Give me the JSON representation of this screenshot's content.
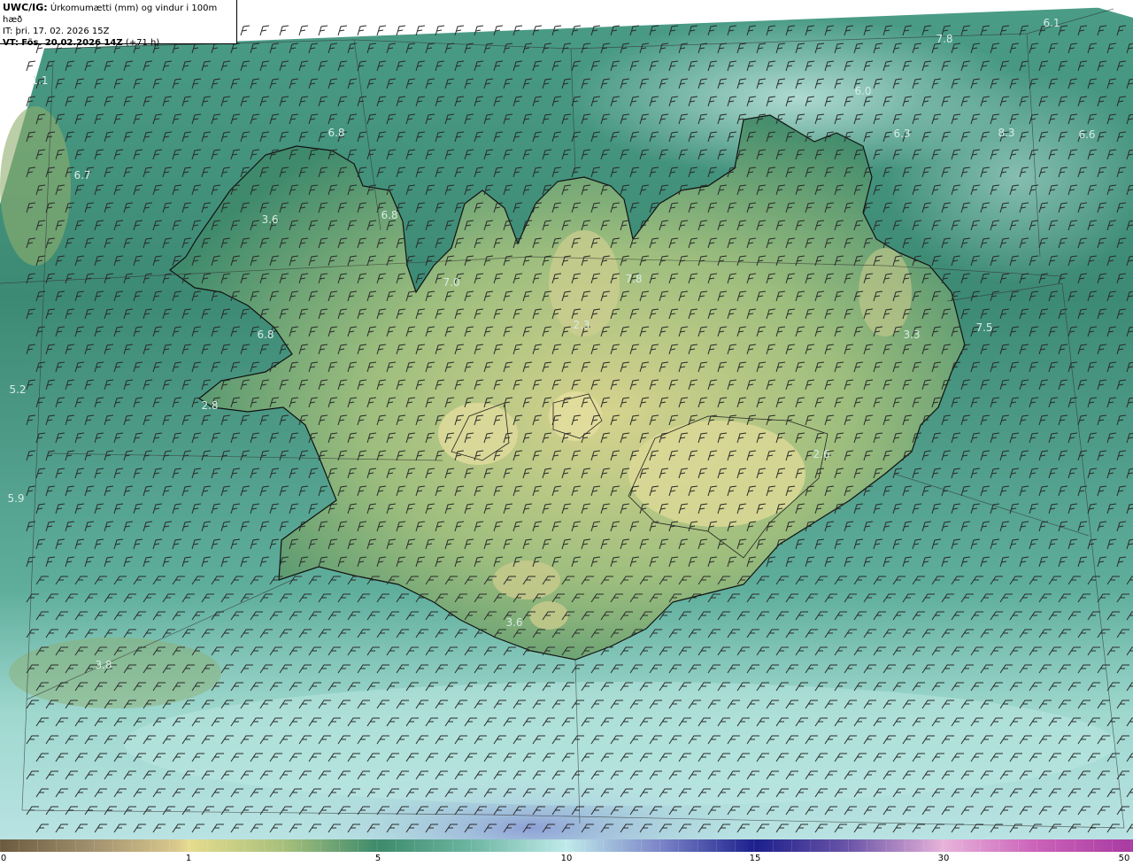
{
  "header": {
    "code": "UWC/IG:",
    "title": "Úrkomumætti (mm) og vindur i 100m hæð",
    "init_prefix": "IT:",
    "init_time": "þri. 17. 02. 2026 15Z",
    "valid_prefix": "VT:",
    "valid_time": "Fös. 20.02.2026 14Z",
    "lead": "(+71 h)"
  },
  "map_values": [
    "1.1",
    "6.8",
    "6.7",
    "3.6",
    "6.8",
    "7.0",
    "7.8",
    "2.3",
    "6.8",
    "5.2",
    "2.8",
    "5.9",
    "3.8",
    "3.6",
    "2.6",
    "3.3",
    "7.5",
    "6.0",
    "7.8",
    "6.1",
    "6.3",
    "8.3",
    "6.6"
  ],
  "colorbar": {
    "ticks": [
      "0",
      "1",
      "5",
      "10",
      "15",
      "30",
      "50"
    ]
  },
  "colors": {
    "ocean_deep": "#3a8f7c",
    "ocean_light": "#b8e6df",
    "land_low": "#3f8a6c",
    "land_high": "#d8d48a",
    "coast": "#111111",
    "barb": "#333333"
  }
}
